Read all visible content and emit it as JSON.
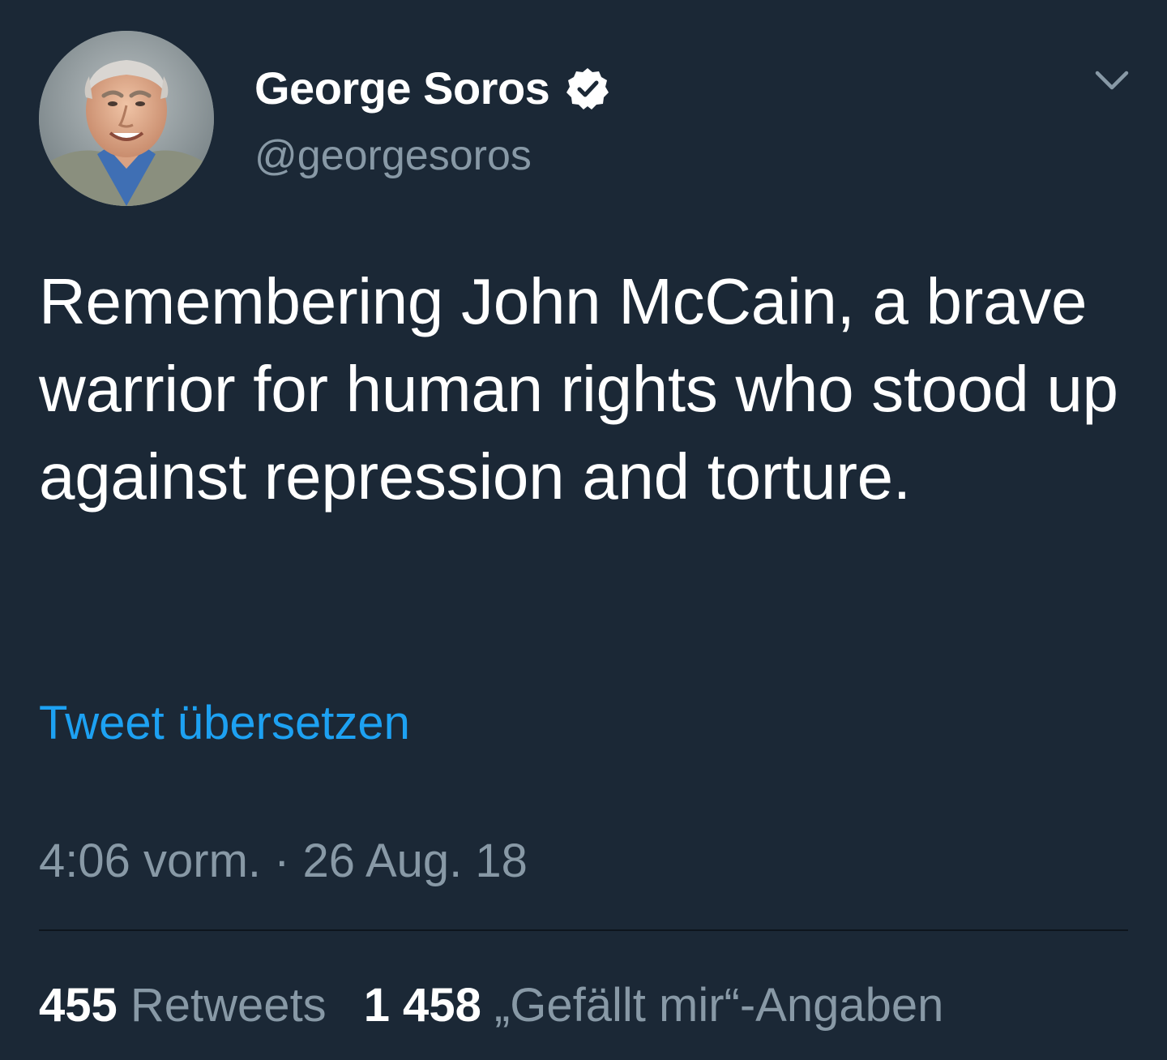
{
  "author": {
    "display_name": "George Soros",
    "handle": "@georgesoros",
    "verified": true,
    "verified_icon": "verified-badge-icon"
  },
  "menu_icon": "chevron-down-icon",
  "tweet": {
    "text": "Remembering John McCain, a brave warrior for human rights who stood up against repression and torture.",
    "translate_label": "Tweet übersetzen",
    "timestamp": "4:06 vorm. · 26 Aug. 18"
  },
  "stats": {
    "retweets_count": "455",
    "retweets_label": "Retweets",
    "likes_count": "1 458",
    "likes_label": "„Gefällt mir“-Angaben"
  },
  "colors": {
    "background": "#1b2836",
    "accent": "#1da1f2",
    "secondary_text": "#8899a6",
    "primary_text": "#ffffff"
  }
}
